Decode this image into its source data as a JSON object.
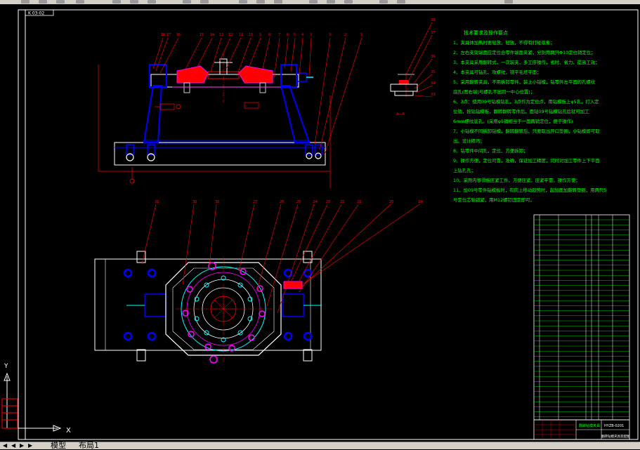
{
  "tabs": {
    "model": "模型",
    "layout": "布局1"
  },
  "drawing": {
    "title_box": "K 03-02",
    "notes_title": "技术要求及操作要点",
    "notes": [
      "1、夹具体加热时要轻放、轻放，不得有打碰现象；",
      "2、左右支架端面应定位合零件端面夹紧，分别用两只Φ10定位销定位；",
      "3、本夹具采用翻转式，一次装夹，多工序操作，省时、省力、提高工效；",
      "4、本夹具可钻孔、攻螺纹，铣平毛坯平面；",
      "5、采用翻转夹具，不用拆卸零件，装上小钻模，钻零件左平面的孔螺纹",
      "底孔(图右端)与螺孔不出同一中心位置)；",
      "6、3点：使用09号钻模钻孔，3点作为定位点，用钻模板上φ5孔，打入定",
      "位销，按钻钻模板，翻转翻转零件后，面钻09号钻模钻孔后就可加工",
      "6mm螺纹底孔。(采用φ5销相当于一面两销定位，便于操作)",
      "7、小钻模不同拆卸钻模，翻转翻转后，只要取出开口垫圈，小钻模即可取",
      "出，设计精巧；",
      "8、钻零件中间孔，定位、方便拆卸；",
      "9、操作方便，定位可靠，准确，保证加工精度，同时对加工零件上下平面",
      "上钻孔孔；",
      "10、采用内移滑板压紧工件，方便压紧，压紧牢靠，操作方便；",
      "11、加09号零件钻模板时，有向上移动趋势时，起加面加翻转垫圈，用两只5",
      "号定位芯轴锁紧，用M12螺钉固定即可。"
    ],
    "section_label": "A—A",
    "axis_x": "X",
    "axis_y": "Y",
    "title_block_name": "翻转钻模夹具",
    "title_block_code": "HYZB-0201",
    "title_block_sub": "翻转钻模夹具装配图"
  },
  "colors": {
    "background": "#000000",
    "outline": "#ffffff",
    "blue": "#0000ff",
    "red": "#ff0000",
    "magenta": "#ff00ff",
    "cyan": "#00ffff",
    "green": "#00ff00",
    "yellow": "#ffff00"
  }
}
